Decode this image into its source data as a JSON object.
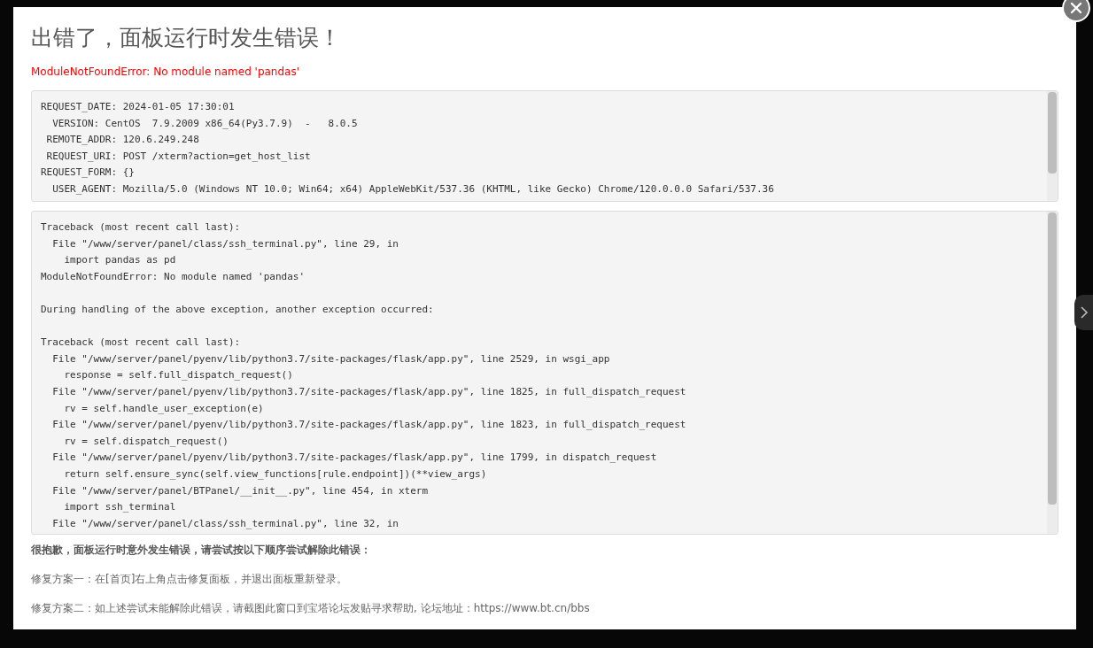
{
  "dialog": {
    "title": "出错了，面板运行时发生错误！",
    "error_message": "ModuleNotFoundError: No module named 'pandas'",
    "request_info": [
      "REQUEST_DATE: 2024-01-05 17:30:01",
      "  VERSION: CentOS  7.9.2009 x86_64(Py3.7.9)  -   8.0.5",
      " REMOTE_ADDR: 120.6.249.248",
      " REQUEST_URI: POST /xterm?action=get_host_list",
      "REQUEST_FORM: {}",
      "  USER_AGENT: Mozilla/5.0 (Windows NT 10.0; Win64; x64) AppleWebKit/537.36 (KHTML, like Gecko) Chrome/120.0.0.0 Safari/537.36"
    ],
    "traceback": [
      [
        "Traceback (most recent call last):",
        "  File \"/www/server/panel/class/ssh_terminal.py\", line 29, in",
        "    import pandas as pd",
        "ModuleNotFoundError: No module named 'pandas'"
      ],
      [
        "During handling of the above exception, another exception occurred:"
      ],
      [
        "Traceback (most recent call last):",
        "  File \"/www/server/panel/pyenv/lib/python3.7/site-packages/flask/app.py\", line 2529, in wsgi_app",
        "    response = self.full_dispatch_request()",
        "  File \"/www/server/panel/pyenv/lib/python3.7/site-packages/flask/app.py\", line 1825, in full_dispatch_request",
        "    rv = self.handle_user_exception(e)",
        "  File \"/www/server/panel/pyenv/lib/python3.7/site-packages/flask/app.py\", line 1823, in full_dispatch_request",
        "    rv = self.dispatch_request()",
        "  File \"/www/server/panel/pyenv/lib/python3.7/site-packages/flask/app.py\", line 1799, in dispatch_request",
        "    return self.ensure_sync(self.view_functions[rule.endpoint])(**view_args)",
        "  File \"/www/server/panel/BTPanel/__init__.py\", line 454, in xterm",
        "    import ssh_terminal",
        "  File \"/www/server/panel/class/ssh_terminal.py\", line 32, in"
      ]
    ],
    "help_heading": "很抱歉，面板运行时意外发生错误，请尝试按以下顺序尝试解除此错误：",
    "fixes": [
      "修复方案一：在[首页]右上角点击修复面板，并退出面板重新登录。",
      "修复方案二：如上述尝试未能解除此错误，请截图此窗口到宝塔论坛发贴寻求帮助, 论坛地址：https://www.bt.cn/bbs"
    ]
  }
}
